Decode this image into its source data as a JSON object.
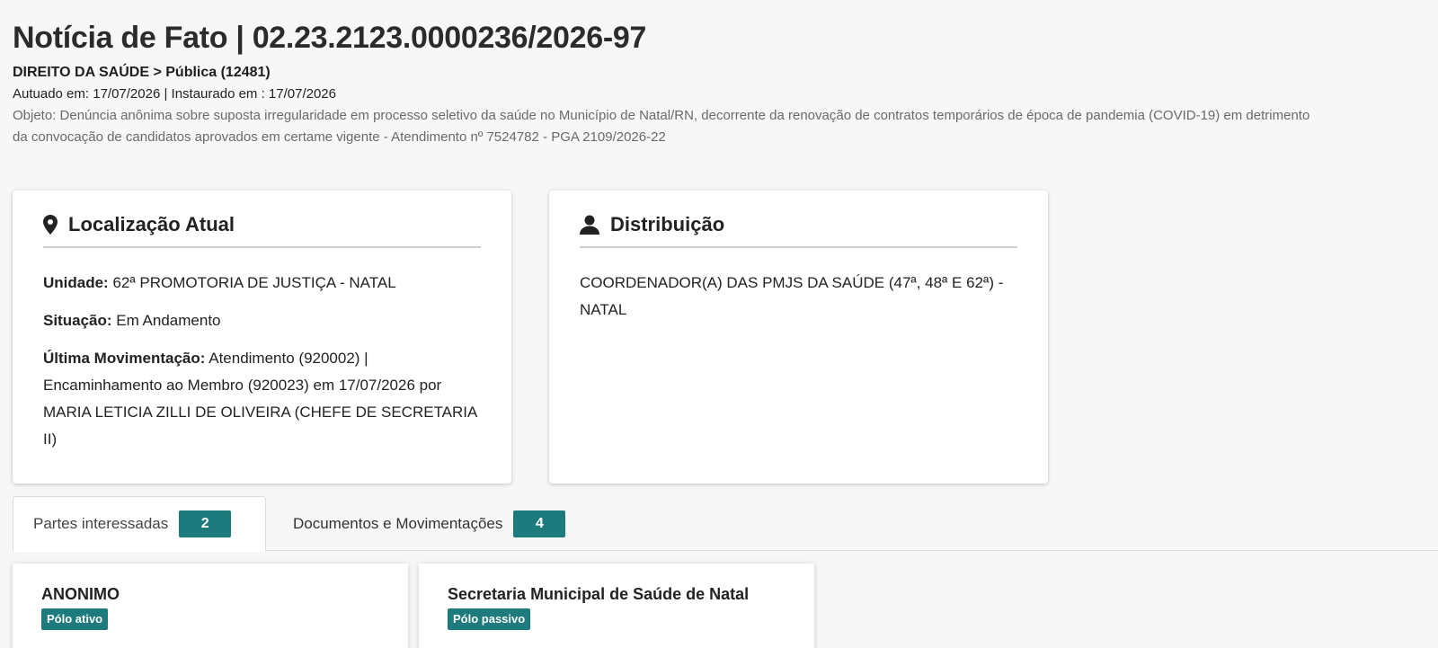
{
  "header": {
    "title": "Notícia de Fato | 02.23.2123.0000236/2026-97",
    "subject": "DIREITO DA SAÚDE > Pública (12481)",
    "dates": "Autuado em: 17/07/2026 | Instaurado em : 17/07/2026",
    "objeto": "Objeto: Denúncia anônima sobre suposta irregularidade em processo seletivo da saúde no Município de Natal/RN, decorrente da renovação de contratos temporários de época de pandemia (COVID-19) em detrimento da convocação de candidatos aprovados em certame vigente - Atendimento nº 7524782 - PGA 2109/2026-22"
  },
  "location_card": {
    "title": "Localização Atual",
    "icon": "map-marker-icon",
    "unidade_label": "Unidade:",
    "unidade_value": "62ª PROMOTORIA DE JUSTIÇA - NATAL",
    "situacao_label": "Situação:",
    "situacao_value": "Em Andamento",
    "ultima_label": "Última Movimentação:",
    "ultima_value": "Atendimento (920002) | Encaminhamento ao Membro (920023) em 17/07/2026 por MARIA LETICIA ZILLI DE OLIVEIRA (CHEFE DE SECRETARIA II)"
  },
  "distribution_card": {
    "title": "Distribuição",
    "icon": "user-icon",
    "text": "COORDENADOR(A) DAS PMJS DA SAÚDE (47ª, 48ª E 62ª) - NATAL"
  },
  "tabs": [
    {
      "label": "Partes interessadas",
      "count": "2",
      "active": true
    },
    {
      "label": "Documentos e Movimentações",
      "count": "4",
      "active": false
    }
  ],
  "parties": [
    {
      "name": "ANONIMO",
      "badge": "Pólo ativo"
    },
    {
      "name": "Secretaria Municipal de Saúde de Natal",
      "badge": "Pólo passivo"
    }
  ],
  "colors": {
    "accent": "#1d7a7d",
    "background": "#f7f7f7",
    "muted_text": "#6a6a6a"
  }
}
